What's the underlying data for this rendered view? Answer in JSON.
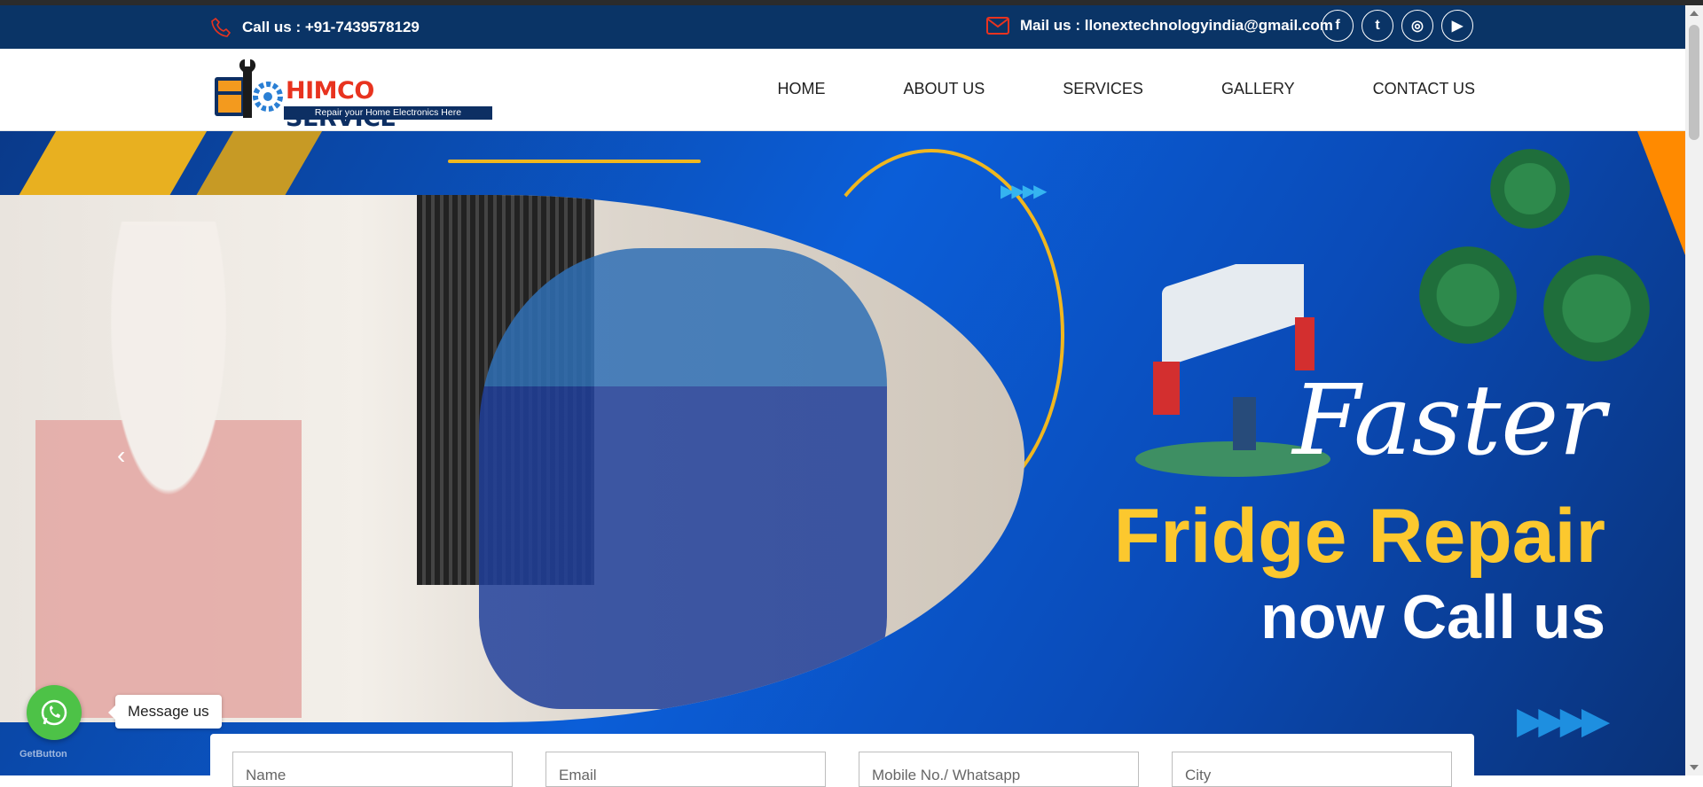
{
  "topbar": {
    "call_text": "Call us : +91-7439578129",
    "mail_text": "Mail us : llonextechnologyindia@gmail.com",
    "social": [
      {
        "name": "facebook-icon",
        "glyph": "f"
      },
      {
        "name": "twitter-icon",
        "glyph": "t"
      },
      {
        "name": "instagram-icon",
        "glyph": "◎"
      },
      {
        "name": "youtube-icon",
        "glyph": "▶"
      }
    ],
    "colors": {
      "background": "#0a3466",
      "accent": "#e8331f"
    }
  },
  "logo": {
    "brand_part1": "HIMCO",
    "brand_part2": " SERVICE",
    "tagline": "Repair your Home Electronics Here"
  },
  "nav": {
    "items": [
      "HOME",
      "ABOUT US",
      "SERVICES",
      "GALLERY",
      "CONTACT US"
    ]
  },
  "hero": {
    "headline_script": "Faster",
    "headline_main": "Fridge Repair",
    "headline_sub": "now Call us",
    "prev_glyph": "‹",
    "arrows_glyph": "▶▶▶▶",
    "colors": {
      "highlight": "#fcc82e",
      "background": "#0b5ed8"
    }
  },
  "form": {
    "placeholders": [
      "Name",
      "Email",
      "Mobile No./ Whatsapp",
      "City"
    ]
  },
  "whatsapp": {
    "label": "Message us",
    "credit": "GetButton",
    "color": "#4dc247"
  }
}
